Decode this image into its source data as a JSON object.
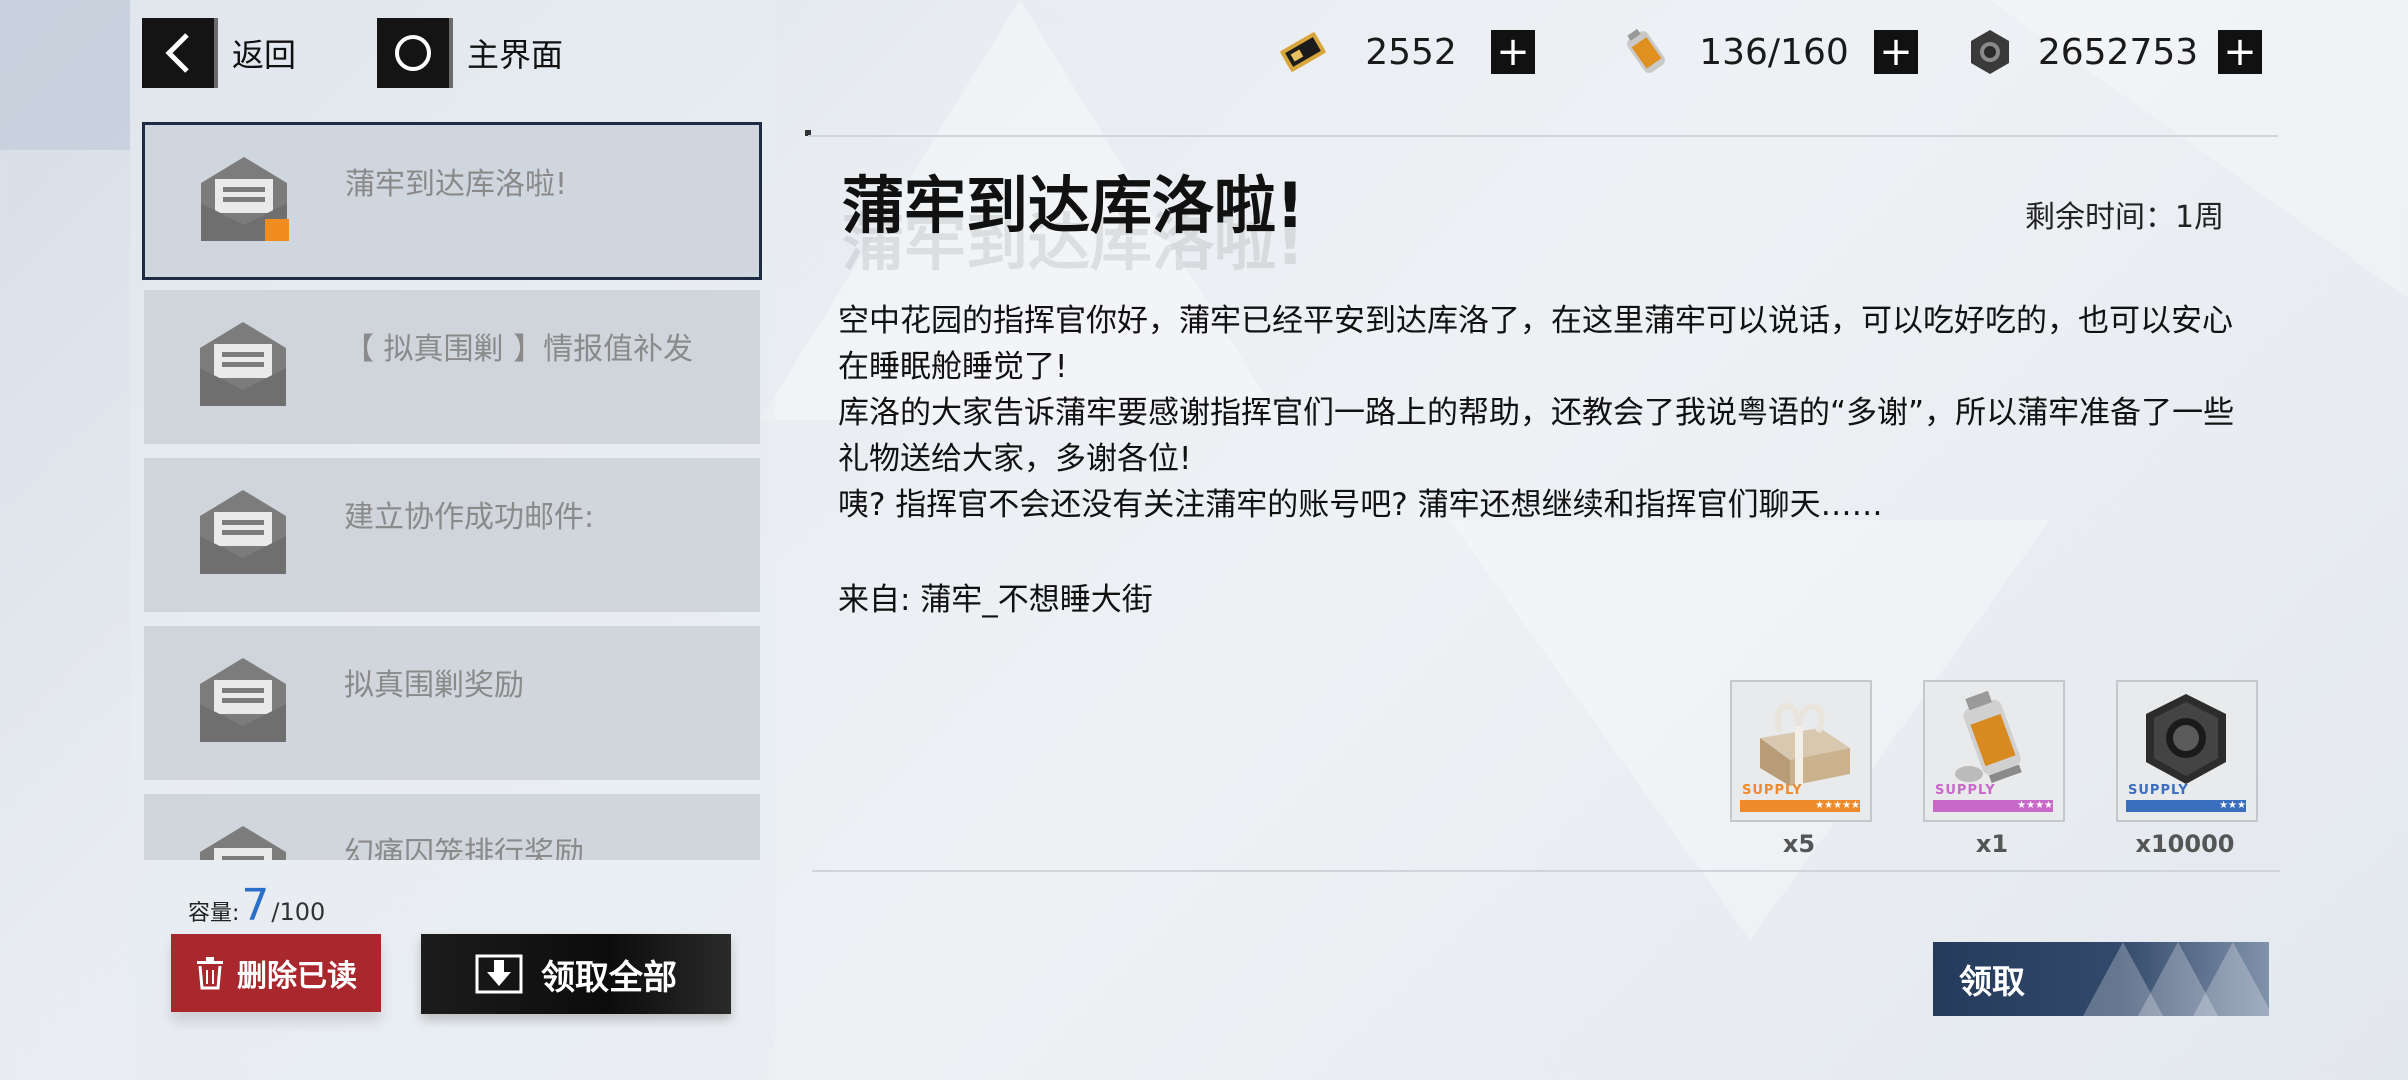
{
  "nav": {
    "back_label": "返回",
    "home_label": "主界面"
  },
  "resources": [
    {
      "icon": "ticket-icon",
      "value": "2552"
    },
    {
      "icon": "battery-icon",
      "value": "136/160"
    },
    {
      "icon": "hex-nut-icon",
      "value": "2652753"
    }
  ],
  "mail_list": [
    {
      "title": "蒲牢到达库洛啦!",
      "selected": true,
      "has_attachment": true
    },
    {
      "title": "【 拟真围剿 】情报值补发",
      "selected": false
    },
    {
      "title": "建立协作成功邮件:",
      "selected": false
    },
    {
      "title": "拟真围剿奖励",
      "selected": false
    },
    {
      "title": "幻痛囚笼排行奖励",
      "selected": false
    }
  ],
  "capacity": {
    "label": "容量:",
    "count": "7",
    "max": "/100"
  },
  "buttons": {
    "delete_read": "删除已读",
    "claim_all": "领取全部",
    "claim": "领取"
  },
  "detail": {
    "title": "蒲牢到达库洛啦!",
    "remaining_time": "剩余时间：1周",
    "body": [
      "空中花园的指挥官你好，蒲牢已经平安到达库洛了，在这里蒲牢可以说话，可以吃好吃的，也可以安心在睡眠舱睡觉了!",
      "库洛的大家告诉蒲牢要感谢指挥官们一路上的帮助，还教会了我说粤语的“多谢”，所以蒲牢准备了一些礼物送给大家，多谢各位!",
      "咦? 指挥官不会还没有关注蒲牢的账号吧? 蒲牢还想继续和指挥官们聊天……"
    ],
    "sender": "来自: 蒲牢_不想睡大街"
  },
  "rewards": [
    {
      "icon": "gift-box-icon",
      "supply_text": "SUPPLY",
      "stars": "★★★★★",
      "band_color": "#ef8a2a",
      "qty": "x5"
    },
    {
      "icon": "battery-canister-icon",
      "supply_text": "SUPPLY",
      "stars": "★★★★",
      "band_color": "#c868c8",
      "qty": "x1"
    },
    {
      "icon": "hex-nut-icon",
      "supply_text": "SUPPLY",
      "stars": "★★★",
      "band_color": "#3a6fc0",
      "qty": "x10000"
    }
  ]
}
